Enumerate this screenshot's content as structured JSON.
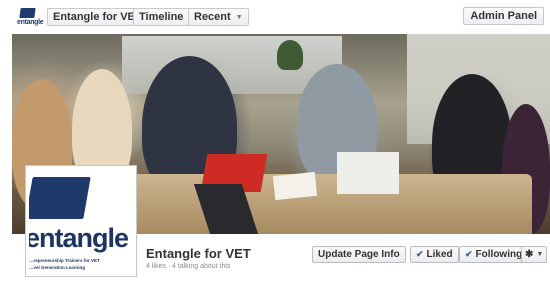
{
  "topbar": {
    "logo_word": "entangle",
    "nav": [
      {
        "label": "Entangle for VET",
        "has_caret": false
      },
      {
        "label": "Timeline",
        "has_caret": true
      },
      {
        "label": "Recent",
        "has_caret": true
      }
    ],
    "admin_label": "Admin Panel"
  },
  "profile": {
    "logo_word": "entangle",
    "tagline_1": "…repreneurship Trainers for VET",
    "tagline_2": "…vel Generation Learning"
  },
  "page": {
    "name": "Entangle for VET",
    "stats": "4 likes · 4 talking about this"
  },
  "actions": {
    "update_label": "Update Page Info",
    "liked_label": "Liked",
    "following_label": "Following",
    "gear_icon": "gear-icon",
    "check_icon": "check-icon"
  },
  "colors": {
    "brand_navy": "#1e3563",
    "accent_red": "#cf2b25"
  }
}
